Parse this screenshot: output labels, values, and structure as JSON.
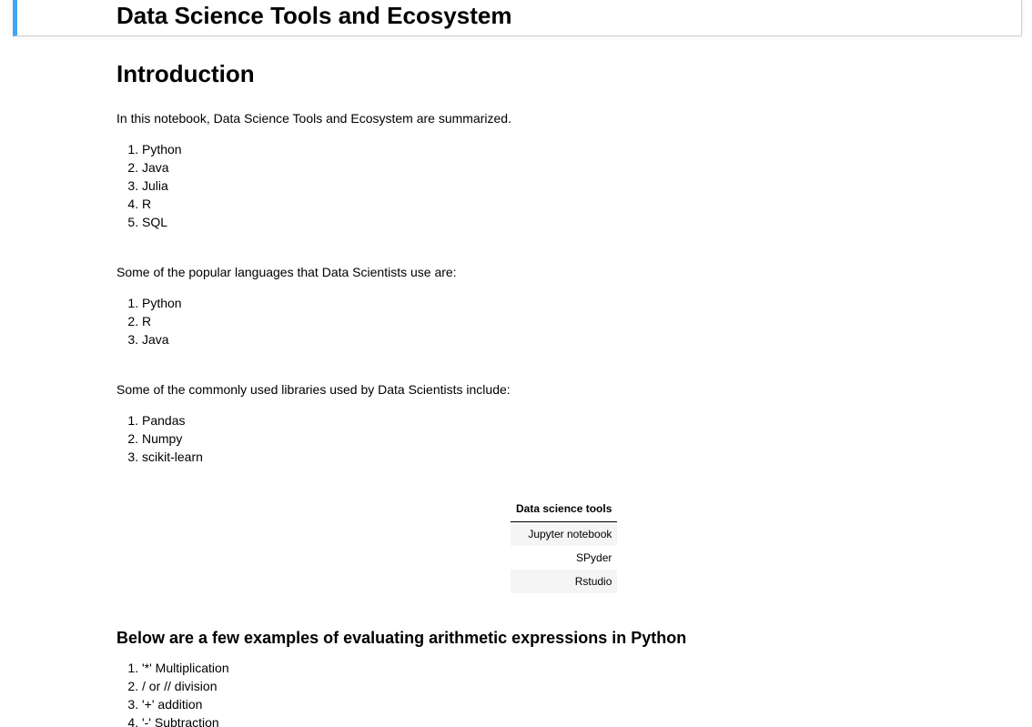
{
  "header": {
    "title": "Data Science Tools and Ecosystem"
  },
  "intro": {
    "heading": "Introduction",
    "text": "In this notebook, Data Science Tools and Ecosystem are summarized.",
    "items": [
      "Python",
      "Java",
      "Julia",
      "R",
      "SQL"
    ]
  },
  "languages": {
    "text": "Some of the popular languages that Data Scientists use are:",
    "items": [
      "Python",
      "R",
      "Java"
    ]
  },
  "libraries": {
    "text": "Some of the commonly used libraries used by Data Scientists include:",
    "items": [
      "Pandas",
      "Numpy",
      "scikit-learn"
    ]
  },
  "tools_table": {
    "header": "Data science tools",
    "rows": [
      "Jupyter notebook",
      "SPyder",
      "Rstudio"
    ]
  },
  "arithmetic": {
    "heading": "Below are a few examples of evaluating arithmetic expressions in Python",
    "items": [
      "'*' Multiplication",
      "/ or // division",
      "'+' addition",
      "'-' Subtraction"
    ]
  },
  "colors": {
    "selection_accent": "#42a5f5",
    "cell_border": "#cfcfcf",
    "table_stripe": "#f5f5f5"
  }
}
